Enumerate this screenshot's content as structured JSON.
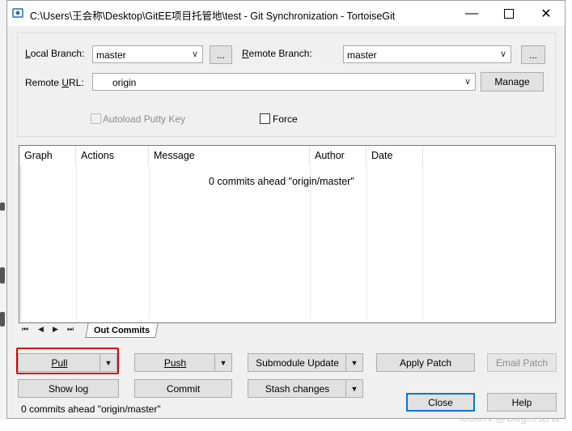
{
  "window": {
    "title": "C:\\Users\\王会称\\Desktop\\GitEE项目托管地\\test - Git Synchronization - TortoiseGit",
    "minimize_icon": "minimize-icon",
    "maximize_icon": "maximize-icon",
    "close_icon": "close-icon"
  },
  "branches": {
    "local_label": "Local Branch:",
    "local_value": "master",
    "local_browse": "...",
    "remote_label": "Remote Branch:",
    "remote_value": "master",
    "remote_browse": "...",
    "url_label": "Remote URL:",
    "url_value": "origin",
    "manage": "Manage"
  },
  "options": {
    "autoload_putty": "Autoload Putty Key",
    "force": "Force"
  },
  "commits_list": {
    "columns": [
      "Graph",
      "Actions",
      "Message",
      "Author",
      "Date"
    ],
    "empty_message": "0 commits ahead \"origin/master\""
  },
  "tabs": {
    "active": "Out Commits"
  },
  "buttons": {
    "pull": "Pull",
    "push": "Push",
    "submodule_update": "Submodule Update",
    "apply_patch": "Apply Patch",
    "email_patch": "Email Patch",
    "show_log": "Show log",
    "commit": "Commit",
    "stash_changes": "Stash changes",
    "close": "Close",
    "help": "Help"
  },
  "status": "0 commits ahead \"origin/master\"",
  "watermark": "CSDN @Bug终结者"
}
